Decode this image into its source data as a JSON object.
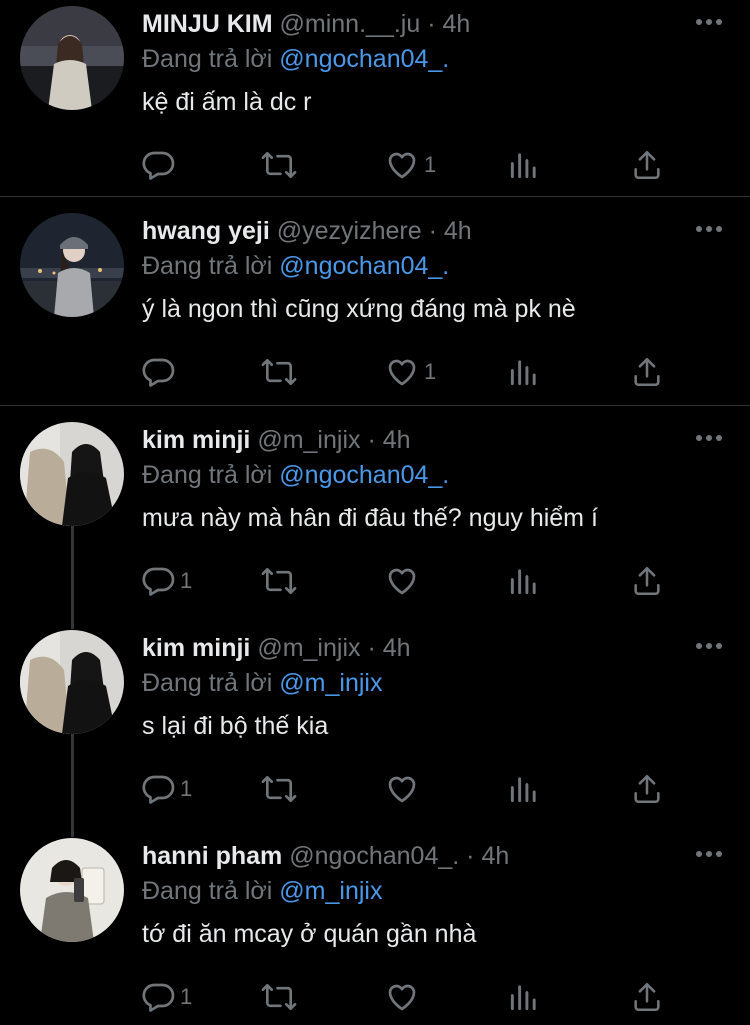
{
  "reply_prefix": "Đang trả lời",
  "tweets": [
    {
      "name": "MINJU KIM",
      "handle": "@minn.__.ju",
      "dot": "·",
      "time": "4h",
      "reply_to": "@ngochan04_.",
      "text": "kệ đi ấm là dc r",
      "replies": "",
      "likes": "1"
    },
    {
      "name": "hwang yeji",
      "handle": "@yezyizhere",
      "dot": "·",
      "time": "4h",
      "reply_to": "@ngochan04_.",
      "text": "ý là ngon thì cũng xứng đáng mà pk nè",
      "replies": "",
      "likes": "1"
    },
    {
      "name": "kim minji",
      "handle": "@m_injix",
      "dot": "·",
      "time": "4h",
      "reply_to": "@ngochan04_.",
      "text": "mưa này mà hân đi đâu thế? nguy hiểm í",
      "replies": "1",
      "likes": ""
    },
    {
      "name": "kim minji",
      "handle": "@m_injix",
      "dot": "·",
      "time": "4h",
      "reply_to": "@m_injix",
      "text": "s lại đi bộ thế kia",
      "replies": "1",
      "likes": ""
    },
    {
      "name": "hanni pham",
      "handle": "@ngochan04_.",
      "dot": "·",
      "time": "4h",
      "reply_to": "@m_injix",
      "text": "tớ đi ăn mcay ở quán gần nhà",
      "replies": "1",
      "likes": ""
    }
  ],
  "colors": {
    "background": "#000000",
    "text": "#e7e9ea",
    "muted": "#71767b",
    "mention": "#4a99e9",
    "divider": "#2f3336"
  },
  "icons": [
    "more-icon",
    "reply-icon",
    "retweet-icon",
    "like-icon",
    "views-icon",
    "share-icon"
  ]
}
